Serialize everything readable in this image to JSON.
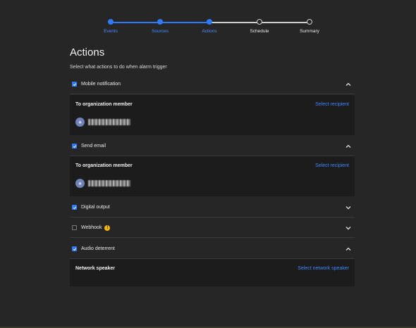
{
  "stepper": {
    "steps": [
      {
        "label": "Events",
        "state": "done"
      },
      {
        "label": "Sources",
        "state": "done"
      },
      {
        "label": "Actions",
        "state": "done"
      },
      {
        "label": "Schedule",
        "state": "todo"
      },
      {
        "label": "Summary",
        "state": "todo"
      }
    ]
  },
  "page": {
    "title": "Actions",
    "subtitle": "Select what actions to do when alarm trigger"
  },
  "actions": {
    "mobile": {
      "label": "Mobile notification",
      "checked": true,
      "expanded": true
    },
    "email": {
      "label": "Send email",
      "checked": true,
      "expanded": true
    },
    "digital": {
      "label": "Digital output",
      "checked": true,
      "expanded": false
    },
    "webhook": {
      "label": "Webhook",
      "checked": false,
      "expanded": false,
      "warning_icon": "!"
    },
    "audio": {
      "label": "Audio deterrent",
      "checked": true,
      "expanded": true
    }
  },
  "panels": {
    "mobile": {
      "title": "To organization member",
      "link": "Select recipient"
    },
    "email": {
      "title": "To organization member",
      "link": "Select recipient"
    },
    "audio": {
      "title": "Network speaker",
      "link": "Select network speaker"
    }
  },
  "colors": {
    "accent": "#2f7bff",
    "background": "#262626",
    "panel": "#1c1c1c",
    "warning": "#f2b400"
  },
  "icons": {
    "checkbox_checked": "check-icon",
    "expand": "chevron-down-icon",
    "collapse": "chevron-up-icon",
    "warning": "warning-icon"
  }
}
